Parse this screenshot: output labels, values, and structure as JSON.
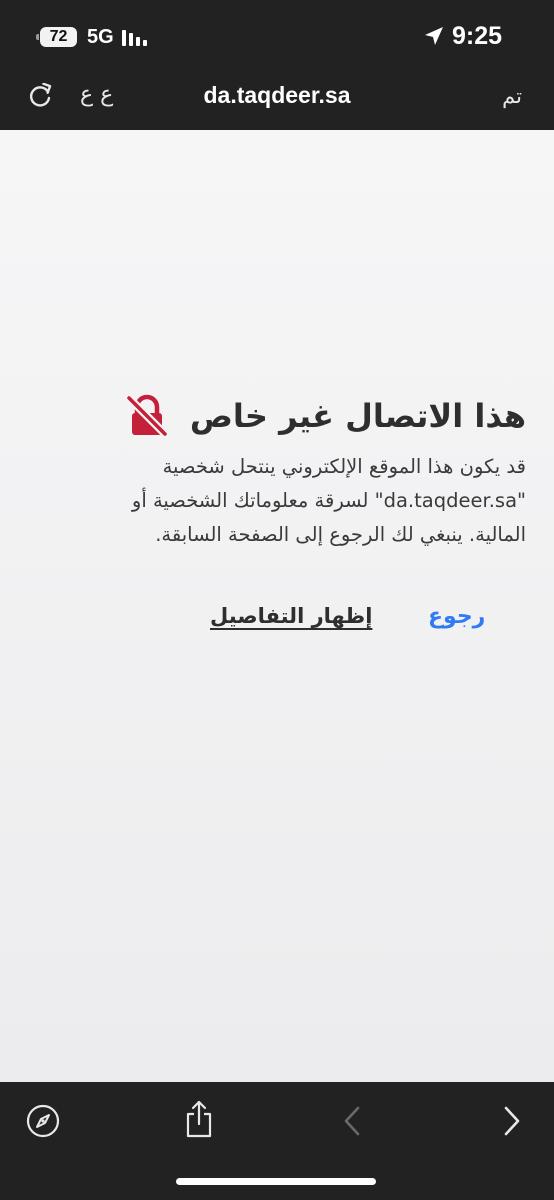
{
  "status_bar": {
    "battery": "72",
    "network": "5G",
    "time": "9:25"
  },
  "address_bar": {
    "text_size_label": "ع ع",
    "url": "da.taqdeer.sa",
    "done_label": "تم"
  },
  "warning": {
    "title": "هذا الاتصال غير خاص",
    "message_line_1": "قد يكون هذا الموقع الإلكتروني ينتحل شخصية",
    "message_line_2": "\"da.taqdeer.sa\" لسرقة معلوماتك الشخصية أو",
    "message_line_3": "المالية. ينبغي لك الرجوع إلى الصفحة السابقة.",
    "back_label": "رجوع",
    "details_label": "إظهار التفاصيل"
  },
  "colors": {
    "chrome_bg": "#222222",
    "page_bg": "#f2f2f4",
    "link_blue": "#2f7bf5",
    "lock_red": "#c5203a"
  },
  "icons": {
    "reload": "reload-icon",
    "lock": "broken-lock-icon",
    "compass": "compass-icon",
    "share": "share-icon",
    "back": "chevron-left-icon",
    "forward": "chevron-right-icon"
  }
}
